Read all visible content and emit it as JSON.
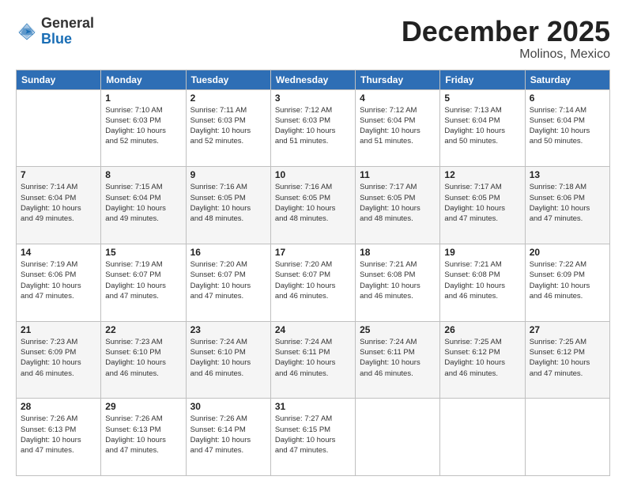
{
  "logo": {
    "general": "General",
    "blue": "Blue"
  },
  "title": "December 2025",
  "subtitle": "Molinos, Mexico",
  "days_of_week": [
    "Sunday",
    "Monday",
    "Tuesday",
    "Wednesday",
    "Thursday",
    "Friday",
    "Saturday"
  ],
  "weeks": [
    [
      {
        "day": "",
        "info": ""
      },
      {
        "day": "1",
        "info": "Sunrise: 7:10 AM\nSunset: 6:03 PM\nDaylight: 10 hours\nand 52 minutes."
      },
      {
        "day": "2",
        "info": "Sunrise: 7:11 AM\nSunset: 6:03 PM\nDaylight: 10 hours\nand 52 minutes."
      },
      {
        "day": "3",
        "info": "Sunrise: 7:12 AM\nSunset: 6:03 PM\nDaylight: 10 hours\nand 51 minutes."
      },
      {
        "day": "4",
        "info": "Sunrise: 7:12 AM\nSunset: 6:04 PM\nDaylight: 10 hours\nand 51 minutes."
      },
      {
        "day": "5",
        "info": "Sunrise: 7:13 AM\nSunset: 6:04 PM\nDaylight: 10 hours\nand 50 minutes."
      },
      {
        "day": "6",
        "info": "Sunrise: 7:14 AM\nSunset: 6:04 PM\nDaylight: 10 hours\nand 50 minutes."
      }
    ],
    [
      {
        "day": "7",
        "info": "Sunrise: 7:14 AM\nSunset: 6:04 PM\nDaylight: 10 hours\nand 49 minutes."
      },
      {
        "day": "8",
        "info": "Sunrise: 7:15 AM\nSunset: 6:04 PM\nDaylight: 10 hours\nand 49 minutes."
      },
      {
        "day": "9",
        "info": "Sunrise: 7:16 AM\nSunset: 6:05 PM\nDaylight: 10 hours\nand 48 minutes."
      },
      {
        "day": "10",
        "info": "Sunrise: 7:16 AM\nSunset: 6:05 PM\nDaylight: 10 hours\nand 48 minutes."
      },
      {
        "day": "11",
        "info": "Sunrise: 7:17 AM\nSunset: 6:05 PM\nDaylight: 10 hours\nand 48 minutes."
      },
      {
        "day": "12",
        "info": "Sunrise: 7:17 AM\nSunset: 6:05 PM\nDaylight: 10 hours\nand 47 minutes."
      },
      {
        "day": "13",
        "info": "Sunrise: 7:18 AM\nSunset: 6:06 PM\nDaylight: 10 hours\nand 47 minutes."
      }
    ],
    [
      {
        "day": "14",
        "info": "Sunrise: 7:19 AM\nSunset: 6:06 PM\nDaylight: 10 hours\nand 47 minutes."
      },
      {
        "day": "15",
        "info": "Sunrise: 7:19 AM\nSunset: 6:07 PM\nDaylight: 10 hours\nand 47 minutes."
      },
      {
        "day": "16",
        "info": "Sunrise: 7:20 AM\nSunset: 6:07 PM\nDaylight: 10 hours\nand 47 minutes."
      },
      {
        "day": "17",
        "info": "Sunrise: 7:20 AM\nSunset: 6:07 PM\nDaylight: 10 hours\nand 46 minutes."
      },
      {
        "day": "18",
        "info": "Sunrise: 7:21 AM\nSunset: 6:08 PM\nDaylight: 10 hours\nand 46 minutes."
      },
      {
        "day": "19",
        "info": "Sunrise: 7:21 AM\nSunset: 6:08 PM\nDaylight: 10 hours\nand 46 minutes."
      },
      {
        "day": "20",
        "info": "Sunrise: 7:22 AM\nSunset: 6:09 PM\nDaylight: 10 hours\nand 46 minutes."
      }
    ],
    [
      {
        "day": "21",
        "info": "Sunrise: 7:23 AM\nSunset: 6:09 PM\nDaylight: 10 hours\nand 46 minutes."
      },
      {
        "day": "22",
        "info": "Sunrise: 7:23 AM\nSunset: 6:10 PM\nDaylight: 10 hours\nand 46 minutes."
      },
      {
        "day": "23",
        "info": "Sunrise: 7:24 AM\nSunset: 6:10 PM\nDaylight: 10 hours\nand 46 minutes."
      },
      {
        "day": "24",
        "info": "Sunrise: 7:24 AM\nSunset: 6:11 PM\nDaylight: 10 hours\nand 46 minutes."
      },
      {
        "day": "25",
        "info": "Sunrise: 7:24 AM\nSunset: 6:11 PM\nDaylight: 10 hours\nand 46 minutes."
      },
      {
        "day": "26",
        "info": "Sunrise: 7:25 AM\nSunset: 6:12 PM\nDaylight: 10 hours\nand 46 minutes."
      },
      {
        "day": "27",
        "info": "Sunrise: 7:25 AM\nSunset: 6:12 PM\nDaylight: 10 hours\nand 47 minutes."
      }
    ],
    [
      {
        "day": "28",
        "info": "Sunrise: 7:26 AM\nSunset: 6:13 PM\nDaylight: 10 hours\nand 47 minutes."
      },
      {
        "day": "29",
        "info": "Sunrise: 7:26 AM\nSunset: 6:13 PM\nDaylight: 10 hours\nand 47 minutes."
      },
      {
        "day": "30",
        "info": "Sunrise: 7:26 AM\nSunset: 6:14 PM\nDaylight: 10 hours\nand 47 minutes."
      },
      {
        "day": "31",
        "info": "Sunrise: 7:27 AM\nSunset: 6:15 PM\nDaylight: 10 hours\nand 47 minutes."
      },
      {
        "day": "",
        "info": ""
      },
      {
        "day": "",
        "info": ""
      },
      {
        "day": "",
        "info": ""
      }
    ]
  ]
}
